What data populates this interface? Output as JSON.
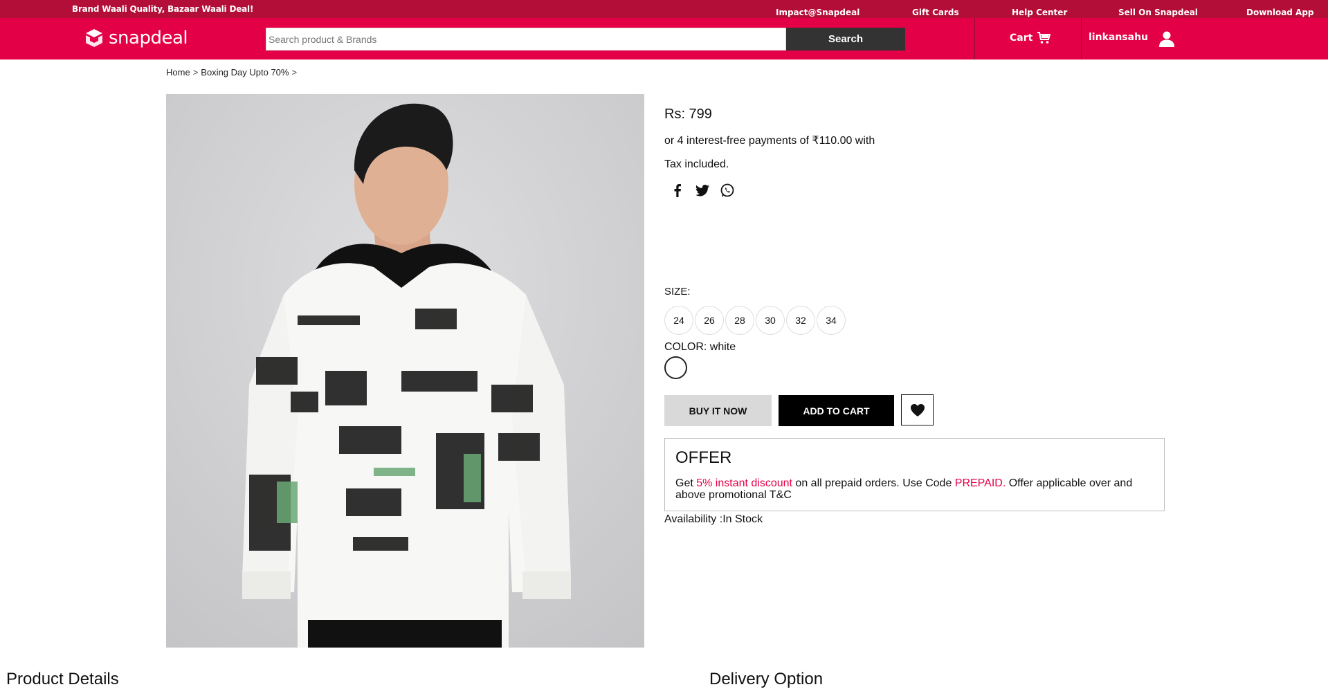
{
  "topbar": {
    "tagline": "Brand Waali Quality, Bazaar Waali Deal!",
    "links": [
      "Impact@Snapdeal",
      "Gift Cards",
      "Help Center",
      "Sell On Snapdeal",
      "Download App"
    ]
  },
  "header": {
    "logo_text": "snapdeal",
    "search_placeholder": "Search product & Brands",
    "search_button": "Search",
    "cart_label": "Cart",
    "username": "linkansahu"
  },
  "breadcrumb": [
    "Home",
    "Boxing Day Upto 70%"
  ],
  "product": {
    "price": "Rs: 799",
    "emi": "or 4 interest-free payments of ₹110.00 with",
    "tax": "Tax included.",
    "size_label": "SIZE:",
    "sizes": [
      "24",
      "26",
      "28",
      "30",
      "32",
      "34"
    ],
    "color_label": "COLOR: white",
    "buy_now": "BUY IT NOW",
    "add_to_cart": "ADD TO CART",
    "availability": "Availability :In Stock"
  },
  "offer": {
    "title": "OFFER",
    "text_1": "Get ",
    "highlight_1": "5% instant discount",
    "text_2": " on all prepaid orders. Use Code ",
    "highlight_2": "PREPAID.",
    "text_3": " Offer applicable over and above promotional T&C"
  },
  "sections": {
    "product_details": "Product Details",
    "delivery_option": "Delivery Option"
  },
  "colors": {
    "brand": "#e40046",
    "topstrip": "#b30e38"
  },
  "icons": [
    "facebook-icon",
    "twitter-icon",
    "whatsapp-icon",
    "cart-icon",
    "user-icon",
    "heart-icon"
  ]
}
